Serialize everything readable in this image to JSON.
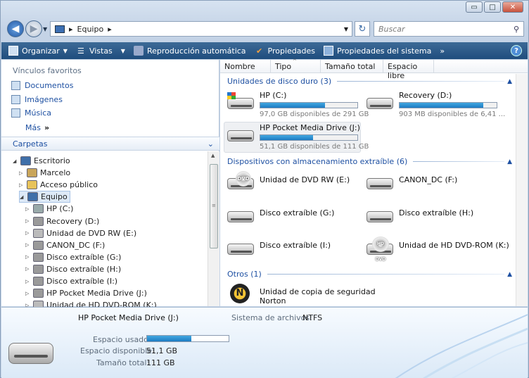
{
  "window": {
    "buttons": [
      {
        "name": "minimize",
        "label": "▭"
      },
      {
        "name": "maximize",
        "label": "□"
      },
      {
        "name": "close",
        "label": "✕"
      }
    ]
  },
  "address": {
    "path": [
      "Equipo"
    ],
    "search_placeholder": "Buscar"
  },
  "toolbar": {
    "organize": "Organizar",
    "views": "Vistas",
    "autoplay": "Reproducción automática",
    "properties": "Propiedades",
    "system_properties": "Propiedades del sistema",
    "more": "»",
    "help": "?"
  },
  "sidebar": {
    "favorites_title": "Vínculos favoritos",
    "favorites": [
      "Documentos",
      "Imágenes",
      "Música"
    ],
    "more_label": "Más",
    "more_chev": "»",
    "folders_title": "Carpetas",
    "tree": [
      {
        "label": "Escritorio",
        "level": 0,
        "icon": "desktop-icon"
      },
      {
        "label": "Marcelo",
        "level": 1,
        "icon": "user-folder-icon"
      },
      {
        "label": "Acceso público",
        "level": 1,
        "icon": "folder-icon"
      },
      {
        "label": "Equipo",
        "level": 1,
        "icon": "computer-icon",
        "selected": true
      },
      {
        "label": "HP (C:)",
        "level": 2,
        "icon": "windows-drive-icon"
      },
      {
        "label": "Recovery (D:)",
        "level": 2,
        "icon": "drive-icon"
      },
      {
        "label": "Unidad de DVD RW (E:)",
        "level": 2,
        "icon": "dvd-icon"
      },
      {
        "label": "CANON_DC (F:)",
        "level": 2,
        "icon": "drive-icon"
      },
      {
        "label": "Disco extraíble (G:)",
        "level": 2,
        "icon": "drive-icon"
      },
      {
        "label": "Disco extraíble (H:)",
        "level": 2,
        "icon": "drive-icon"
      },
      {
        "label": "Disco extraíble (I:)",
        "level": 2,
        "icon": "drive-icon"
      },
      {
        "label": "HP Pocket Media Drive (J:)",
        "level": 2,
        "icon": "drive-icon"
      },
      {
        "label": "Unidad de HD DVD-ROM (K:)",
        "level": 2,
        "icon": "hddvd-icon"
      }
    ]
  },
  "columns": [
    "Nombre",
    "Tipo",
    "Tamaño total",
    "Espacio libre"
  ],
  "groups": {
    "hdd": {
      "title": "Unidades de disco duro (3)",
      "items": [
        {
          "name": "HP (C:)",
          "free": "97,0 GB disponibles de 291 GB",
          "used": 0.67
        },
        {
          "name": "Recovery (D:)",
          "free": "903 MB disponibles de 6,41 ...",
          "used": 0.86
        },
        {
          "name": "HP Pocket Media Drive (J:)",
          "free": "51,1 GB disponibles de 111 GB",
          "used": 0.54
        }
      ]
    },
    "removable": {
      "title": "Dispositivos con almacenamiento extraíble (6)",
      "items": [
        {
          "name": "Unidad de DVD RW (E:)",
          "icon": "dvd-icon"
        },
        {
          "name": "CANON_DC (F:)",
          "icon": "drive-icon"
        },
        {
          "name": "Disco extraíble (G:)",
          "icon": "drive-icon"
        },
        {
          "name": "Disco extraíble (H:)",
          "icon": "drive-icon"
        },
        {
          "name": "Disco extraíble (I:)",
          "icon": "drive-icon"
        },
        {
          "name": "Unidad de HD DVD-ROM (K:)",
          "icon": "hddvd-icon"
        }
      ]
    },
    "other": {
      "title": "Otros (1)",
      "items": [
        {
          "name": "Unidad de copia de seguridad",
          "name2": "Norton",
          "icon": "norton-icon"
        }
      ]
    }
  },
  "details": {
    "name": "HP Pocket Media Drive (J:)",
    "fs_label": "Sistema de archivos:",
    "fs_value": "NTFS",
    "used_label": "Espacio usado:",
    "used": 0.54,
    "free_label": "Espacio disponible:",
    "free_value": "51,1 GB",
    "total_label": "Tamaño total:",
    "total_value": "111 GB"
  }
}
